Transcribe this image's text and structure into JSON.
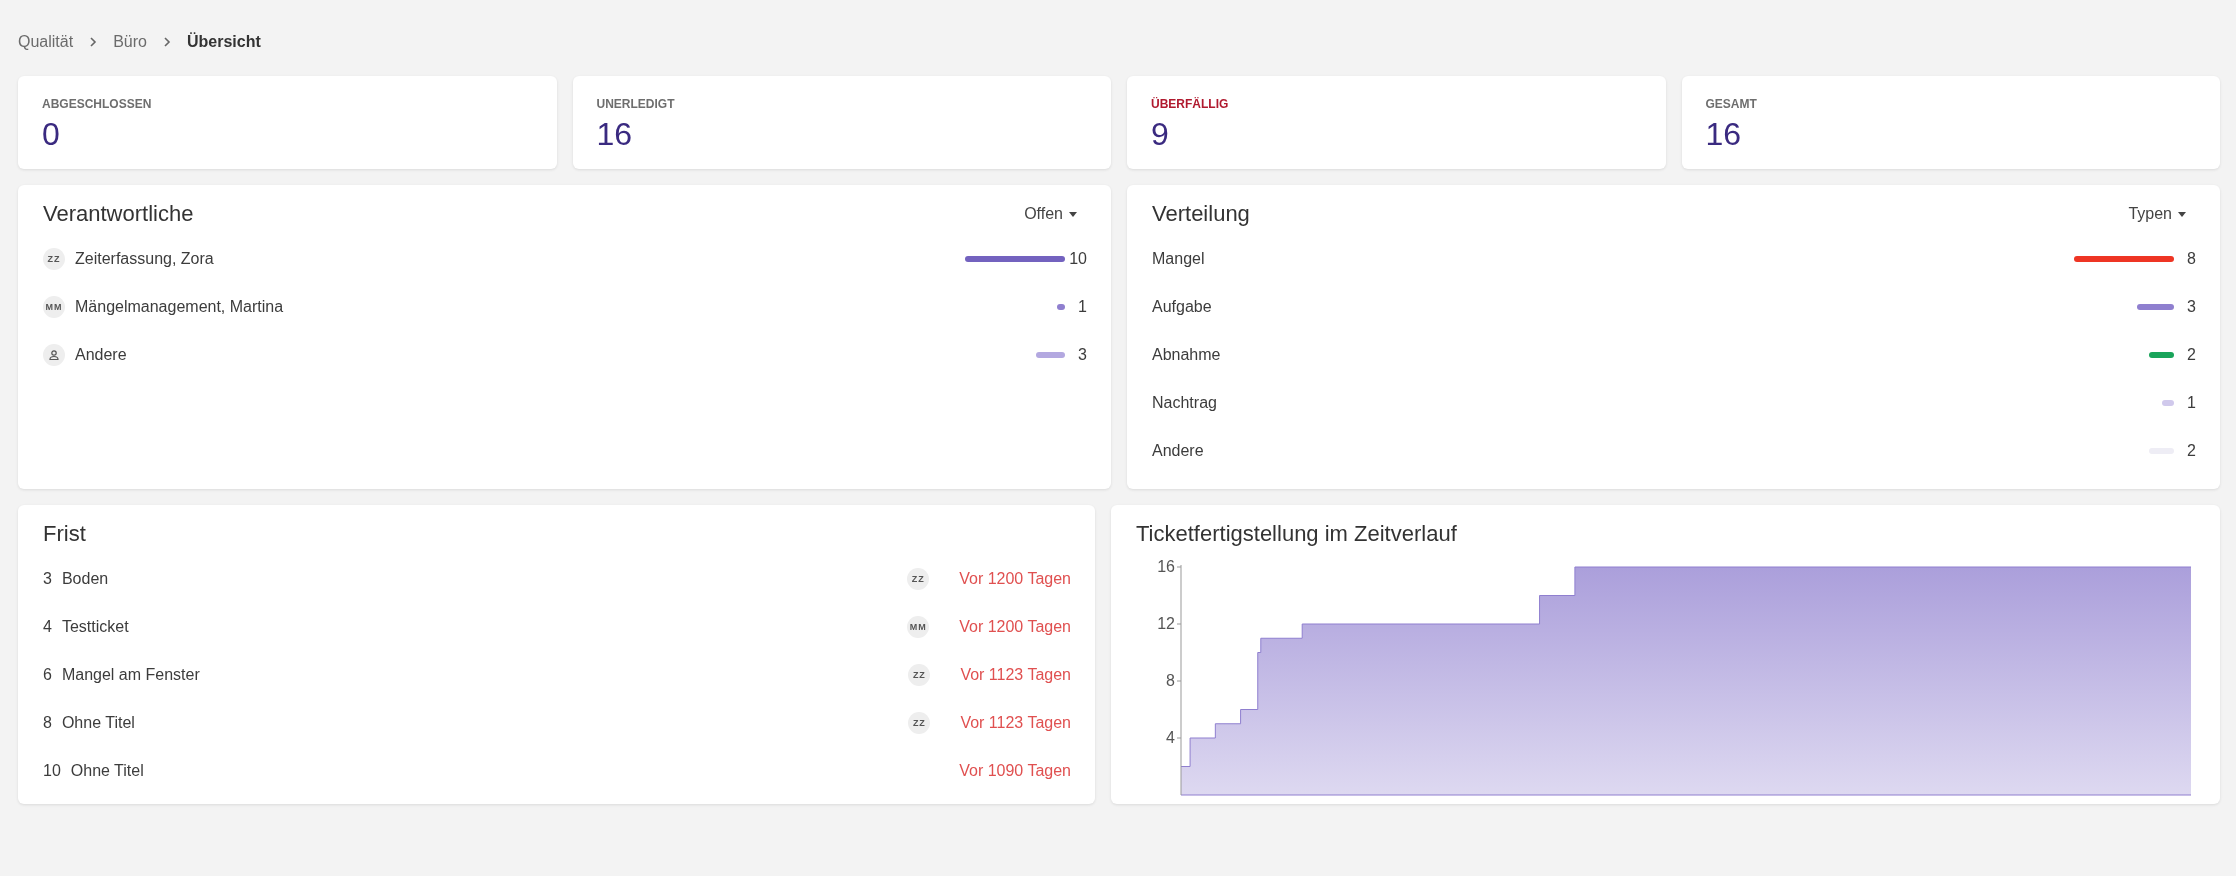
{
  "breadcrumb": [
    {
      "label": "Qualität",
      "selected": false
    },
    {
      "label": "Büro",
      "selected": false
    },
    {
      "label": "Übersicht",
      "selected": true
    }
  ],
  "stats": [
    {
      "label": "ABGESCHLOSSEN",
      "value": "0",
      "alert": false
    },
    {
      "label": "UNERLEDIGT",
      "value": "16",
      "alert": false
    },
    {
      "label": "ÜBERFÄLLIG",
      "value": "9",
      "alert": true
    },
    {
      "label": "GESAMT",
      "value": "16",
      "alert": false
    }
  ],
  "owners": {
    "title": "Verantwortliche",
    "filter": "Offen",
    "items": [
      {
        "avatar": {
          "kind": "initials",
          "text": "ZZ"
        },
        "name": "Zeiterfassung, Zora",
        "count": "10",
        "level": 1,
        "color": "#7362bf"
      },
      {
        "avatar": {
          "kind": "initials",
          "text": "MM"
        },
        "name": "Mängelmanagement, Martina",
        "count": "1",
        "level": 0.08,
        "color": "#8f7fcf"
      },
      {
        "avatar": {
          "kind": "person"
        },
        "name": "Andere",
        "count": "3",
        "level": 0.29,
        "color": "#b3a8e0"
      }
    ]
  },
  "distribution": {
    "title": "Verteilung",
    "filter": "Typen",
    "items": [
      {
        "name": "Mangel",
        "count": "8",
        "level": 1,
        "color": "#ee3524"
      },
      {
        "name": "Aufgabe",
        "count": "3",
        "level": 0.375,
        "color": "#8f7fcf"
      },
      {
        "name": "Abnahme",
        "count": "2",
        "level": 0.25,
        "color": "#19a45a"
      },
      {
        "name": "Nachtrag",
        "count": "1",
        "level": 0.125,
        "color": "#d0c9ec"
      },
      {
        "name": "Andere",
        "count": "2",
        "level": 0.25,
        "color": "#eeedf5"
      }
    ]
  },
  "deadlines": {
    "title": "Frist",
    "items": [
      {
        "number": "3",
        "title": "Boden",
        "avatar": "ZZ",
        "due": "Vor 1200 Tagen"
      },
      {
        "number": "4",
        "title": "Testticket",
        "avatar": "MM",
        "due": "Vor 1200 Tagen"
      },
      {
        "number": "6",
        "title": "Mangel am Fenster",
        "avatar": "ZZ",
        "due": "Vor 1123 Tagen"
      },
      {
        "number": "8",
        "title": "Ohne Titel",
        "avatar": "ZZ",
        "due": "Vor 1123 Tagen"
      },
      {
        "number": "10",
        "title": "Ohne Titel",
        "due": "Vor 1090 Tagen"
      }
    ]
  },
  "completion": {
    "title": "Ticketfertigstellung im Zeitverlauf",
    "y_tick_labels": [
      "16",
      "12",
      "8",
      "4"
    ]
  }
}
